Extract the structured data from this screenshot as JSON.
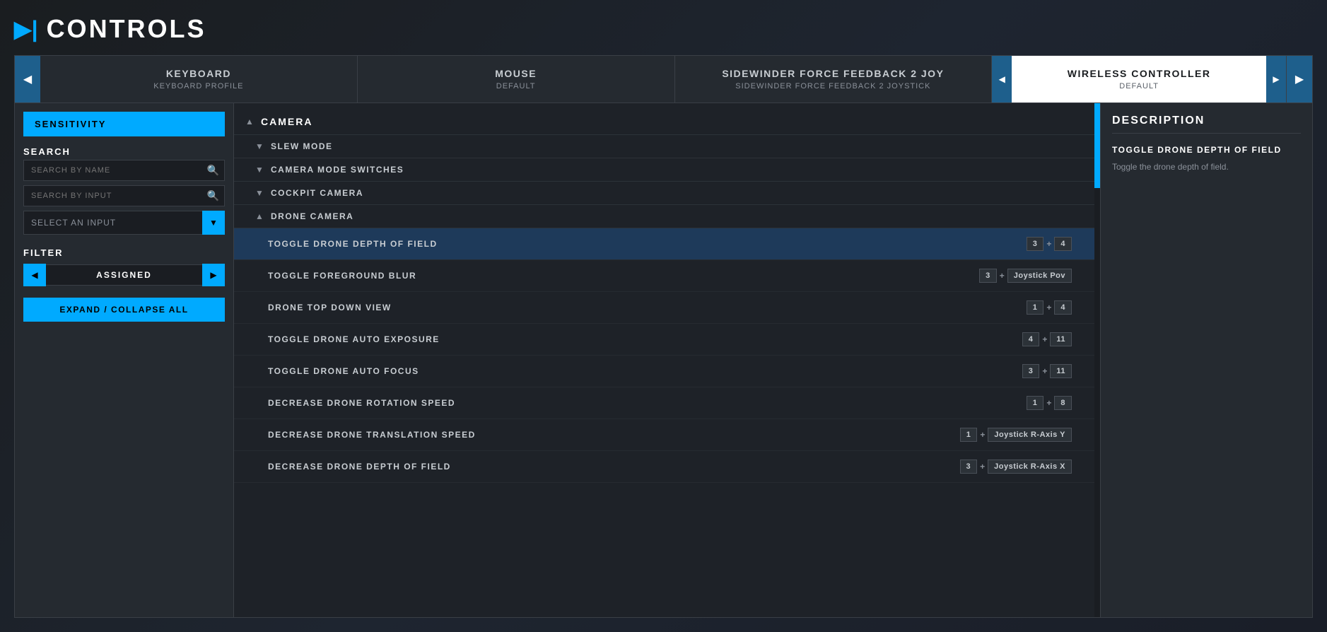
{
  "header": {
    "icon": "▶|",
    "title": "CONTROLS"
  },
  "tabs": [
    {
      "id": "keyboard",
      "name": "KEYBOARD",
      "profile": "KEYBOARD PROFILE",
      "active": false
    },
    {
      "id": "mouse",
      "name": "MOUSE",
      "profile": "DEFAULT",
      "active": false
    },
    {
      "id": "sidewinder",
      "name": "SIDEWINDER FORCE FEEDBACK 2 JOY",
      "profile": "SIDEWINDER FORCE FEEDBACK 2 JOYSTICK",
      "active": false
    },
    {
      "id": "wireless",
      "name": "WIRELESS CONTROLLER",
      "profile": "DEFAULT",
      "active": true
    }
  ],
  "tab_nav": {
    "prev_label": "◀",
    "next_label": "▶"
  },
  "sidebar": {
    "sensitivity_label": "SENSITIVITY",
    "search_label": "SEARCH",
    "search_by_name_placeholder": "SEARCH BY NAME",
    "search_by_input_placeholder": "SEARCH BY INPUT",
    "select_input_label": "Select an input",
    "filter_label": "FILTER",
    "filter_prev": "◀",
    "filter_next": "▶",
    "filter_current": "ASSIGNED",
    "expand_collapse_label": "EXPAND / COLLAPSE ALL"
  },
  "categories": [
    {
      "id": "camera",
      "name": "CAMERA",
      "expanded": true,
      "chevron": "▲",
      "subcategories": [
        {
          "id": "slew_mode",
          "name": "SLEW MODE",
          "expanded": false,
          "chevron": "▼",
          "bindings": []
        },
        {
          "id": "camera_mode",
          "name": "CAMERA MODE SWITCHES",
          "expanded": false,
          "chevron": "▼",
          "bindings": []
        },
        {
          "id": "cockpit",
          "name": "COCKPIT CAMERA",
          "expanded": false,
          "chevron": "▼",
          "bindings": []
        },
        {
          "id": "drone",
          "name": "DRONE CAMERA",
          "expanded": true,
          "chevron": "▲",
          "bindings": [
            {
              "id": "toggle_drone_dof",
              "name": "TOGGLE DRONE DEPTH OF FIELD",
              "selected": true,
              "keys": [
                {
                  "value": "3",
                  "type": "badge"
                },
                {
                  "value": "+",
                  "type": "plus"
                },
                {
                  "value": "4",
                  "type": "badge"
                }
              ]
            },
            {
              "id": "toggle_fg_blur",
              "name": "TOGGLE FOREGROUND BLUR",
              "selected": false,
              "keys": [
                {
                  "value": "3",
                  "type": "badge"
                },
                {
                  "value": "+",
                  "type": "plus"
                },
                {
                  "value": "Joystick Pov",
                  "type": "badge"
                }
              ]
            },
            {
              "id": "drone_top_down",
              "name": "DRONE TOP DOWN VIEW",
              "selected": false,
              "keys": [
                {
                  "value": "1",
                  "type": "badge"
                },
                {
                  "value": "+",
                  "type": "plus"
                },
                {
                  "value": "4",
                  "type": "badge"
                }
              ]
            },
            {
              "id": "toggle_auto_exposure",
              "name": "TOGGLE DRONE AUTO EXPOSURE",
              "selected": false,
              "keys": [
                {
                  "value": "4",
                  "type": "badge"
                },
                {
                  "value": "+",
                  "type": "plus"
                },
                {
                  "value": "11",
                  "type": "badge"
                }
              ]
            },
            {
              "id": "toggle_auto_focus",
              "name": "TOGGLE DRONE AUTO FOCUS",
              "selected": false,
              "keys": [
                {
                  "value": "3",
                  "type": "badge"
                },
                {
                  "value": "+",
                  "type": "plus"
                },
                {
                  "value": "11",
                  "type": "badge"
                }
              ]
            },
            {
              "id": "decrease_rotation",
              "name": "DECREASE DRONE ROTATION SPEED",
              "selected": false,
              "keys": [
                {
                  "value": "1",
                  "type": "badge"
                },
                {
                  "value": "+",
                  "type": "plus"
                },
                {
                  "value": "8",
                  "type": "badge"
                }
              ]
            },
            {
              "id": "decrease_translation",
              "name": "DECREASE DRONE TRANSLATION SPEED",
              "selected": false,
              "keys": [
                {
                  "value": "1",
                  "type": "badge"
                },
                {
                  "value": "+",
                  "type": "plus"
                },
                {
                  "value": "Joystick R-Axis Y",
                  "type": "badge"
                }
              ]
            },
            {
              "id": "decrease_dof",
              "name": "DECREASE DRONE DEPTH OF FIELD",
              "selected": false,
              "keys": [
                {
                  "value": "3",
                  "type": "badge"
                },
                {
                  "value": "+",
                  "type": "plus"
                },
                {
                  "value": "Joystick R-Axis X",
                  "type": "badge"
                }
              ]
            }
          ]
        }
      ]
    }
  ],
  "description": {
    "title": "DESCRIPTION",
    "binding_name": "TOGGLE DRONE DEPTH OF FIELD",
    "text": "Toggle the drone depth of field."
  },
  "scrollbar": {
    "visible": true
  }
}
